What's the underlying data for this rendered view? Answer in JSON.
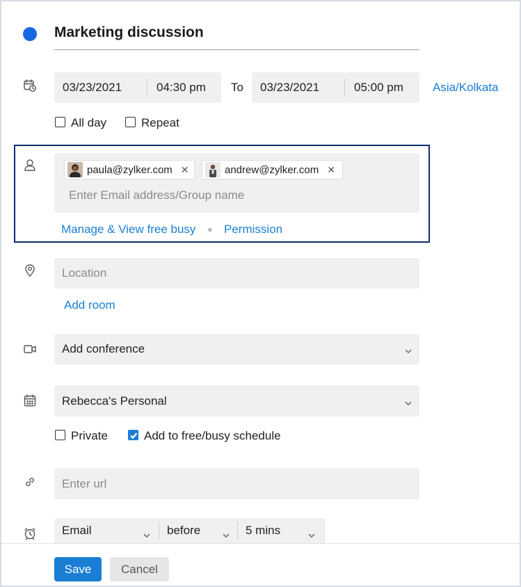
{
  "event": {
    "title": "Marketing discussion",
    "color": "#1769e0"
  },
  "datetime": {
    "start_date": "03/23/2021",
    "start_time": "04:30 pm",
    "to_label": "To",
    "end_date": "03/23/2021",
    "end_time": "05:00 pm",
    "timezone": "Asia/Kolkata"
  },
  "options": {
    "all_day_label": "All day",
    "all_day_checked": false,
    "repeat_label": "Repeat",
    "repeat_checked": false
  },
  "attendees": {
    "chips": [
      {
        "email": "paula@zylker.com"
      },
      {
        "email": "andrew@zylker.com"
      }
    ],
    "placeholder": "Enter Email address/Group name",
    "manage_link": "Manage & View free busy",
    "permission_link": "Permission"
  },
  "location": {
    "placeholder": "Location",
    "add_room_link": "Add room"
  },
  "conference": {
    "value": "Add conference"
  },
  "calendar": {
    "value": "Rebecca's Personal",
    "private_label": "Private",
    "private_checked": false,
    "freebusy_label": "Add to free/busy schedule",
    "freebusy_checked": true
  },
  "url": {
    "placeholder": "Enter url"
  },
  "reminder": {
    "type": "Email",
    "relation": "before",
    "duration": "5 mins"
  },
  "footer": {
    "save_label": "Save",
    "cancel_label": "Cancel"
  },
  "colors": {
    "accent": "#1a7fd4",
    "highlight_border": "#0d2a6e"
  }
}
